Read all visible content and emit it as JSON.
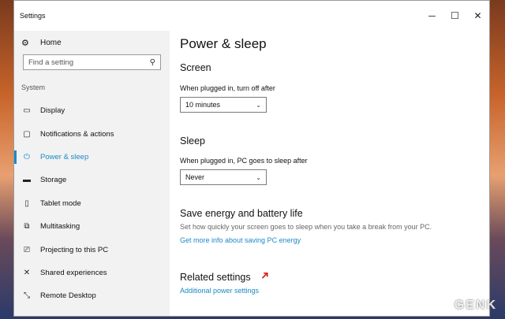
{
  "window": {
    "title": "Settings",
    "controls": {
      "minimize": "─",
      "maximize": "☐",
      "close": "✕"
    }
  },
  "sidebar": {
    "home": {
      "icon": "gear-icon",
      "label": "Home"
    },
    "search": {
      "placeholder": "Find a setting",
      "icon": "search-icon"
    },
    "section": "System",
    "items": [
      {
        "icon": "display-icon",
        "label": "Display"
      },
      {
        "icon": "notifications-icon",
        "label": "Notifications & actions"
      },
      {
        "icon": "power-icon",
        "label": "Power & sleep",
        "active": true
      },
      {
        "icon": "storage-icon",
        "label": "Storage"
      },
      {
        "icon": "tablet-icon",
        "label": "Tablet mode"
      },
      {
        "icon": "multitasking-icon",
        "label": "Multitasking"
      },
      {
        "icon": "projecting-icon",
        "label": "Projecting to this PC"
      },
      {
        "icon": "shared-experiences-icon",
        "label": "Shared experiences"
      },
      {
        "icon": "remote-desktop-icon",
        "label": "Remote Desktop"
      }
    ]
  },
  "main": {
    "title": "Power & sleep",
    "screen": {
      "heading": "Screen",
      "label": "When plugged in, turn off after",
      "value": "10 minutes"
    },
    "sleep": {
      "heading": "Sleep",
      "label": "When plugged in, PC goes to sleep after",
      "value": "Never"
    },
    "energy": {
      "heading": "Save energy and battery life",
      "description": "Set how quickly your screen goes to sleep when you take a break from your PC.",
      "link": "Get more info about saving PC energy"
    },
    "related": {
      "heading": "Related settings",
      "link": "Additional power settings"
    }
  },
  "watermark": "GENK",
  "colors": {
    "accent": "#1a8ac7",
    "annotation_arrow": "#d9221c"
  }
}
